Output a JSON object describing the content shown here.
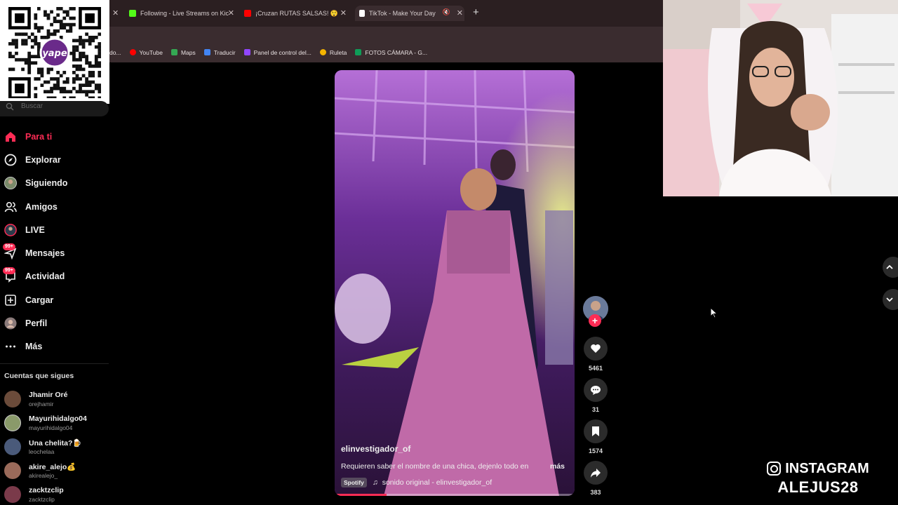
{
  "browser": {
    "tabs": [
      {
        "label": "Following - Live Streams on Kic",
        "icon": "kick-icon",
        "color": "#53fc18"
      },
      {
        "label": "¡Cruzan RUTAS SALSAS! 😲",
        "icon": "youtube-icon",
        "color": "#ff0000"
      },
      {
        "label": "TikTok - Make Your Day",
        "icon": "tiktok-icon",
        "color": "#ffffff",
        "active": true
      }
    ],
    "bookmarks": [
      {
        "label": "do...",
        "icon": "bookmark-icon"
      },
      {
        "label": "YouTube",
        "icon": "youtube-icon"
      },
      {
        "label": "Maps",
        "icon": "maps-icon"
      },
      {
        "label": "Traducir",
        "icon": "translate-icon"
      },
      {
        "label": "Panel de control del...",
        "icon": "twitch-icon"
      },
      {
        "label": "Ruleta",
        "icon": "roulette-icon"
      },
      {
        "label": "FOTOS CÁMARA - G...",
        "icon": "drive-icon"
      }
    ]
  },
  "qr": {
    "brand": "yape"
  },
  "sidebar": {
    "search_placeholder": "Buscar",
    "items": [
      {
        "label": "Para ti",
        "icon": "home-icon",
        "active": true
      },
      {
        "label": "Explorar",
        "icon": "compass-icon"
      },
      {
        "label": "Siguiendo",
        "icon": "following-avatar-icon"
      },
      {
        "label": "Amigos",
        "icon": "friends-icon"
      },
      {
        "label": "LIVE",
        "icon": "live-icon"
      },
      {
        "label": "Mensajes",
        "icon": "messages-icon",
        "badge": "99+"
      },
      {
        "label": "Actividad",
        "icon": "activity-icon",
        "badge": "99+"
      },
      {
        "label": "Cargar",
        "icon": "upload-icon"
      },
      {
        "label": "Perfil",
        "icon": "profile-icon"
      },
      {
        "label": "Más",
        "icon": "more-icon"
      }
    ],
    "following_title": "Cuentas que sigues",
    "following": [
      {
        "name": "Jhamir Oré",
        "user": "orejhamir",
        "color": "#6b4b3a"
      },
      {
        "name": "Mayurihidalgo04",
        "user": "mayurihidalgo04",
        "color": "#8a9a6a"
      },
      {
        "name": "Una chelita?🍺",
        "user": "leochelaa",
        "color": "#4a5a7a"
      },
      {
        "name": "akire_alejo💰",
        "user": "akirealejo_",
        "color": "#9a6a5a"
      },
      {
        "name": "zacktzclip",
        "user": "zacktzclip",
        "color": "#7a3a4a"
      }
    ]
  },
  "video": {
    "username": "elinvestigador_of",
    "caption": "Requieren saber el nombre de una chica, dejenlo todo en",
    "more_label": "más",
    "spotify_label": "Spotify",
    "sound": "sonido original - elinvestigador_of",
    "progress": 0.21
  },
  "actions": {
    "likes": "5461",
    "comments": "31",
    "saves": "1574",
    "shares": "383"
  },
  "overlay": {
    "instagram_label": "INSTAGRAM",
    "instagram_handle": "ALEJUS28"
  },
  "colors": {
    "accent": "#fe2c55",
    "sidebar_bg": "#000000"
  }
}
